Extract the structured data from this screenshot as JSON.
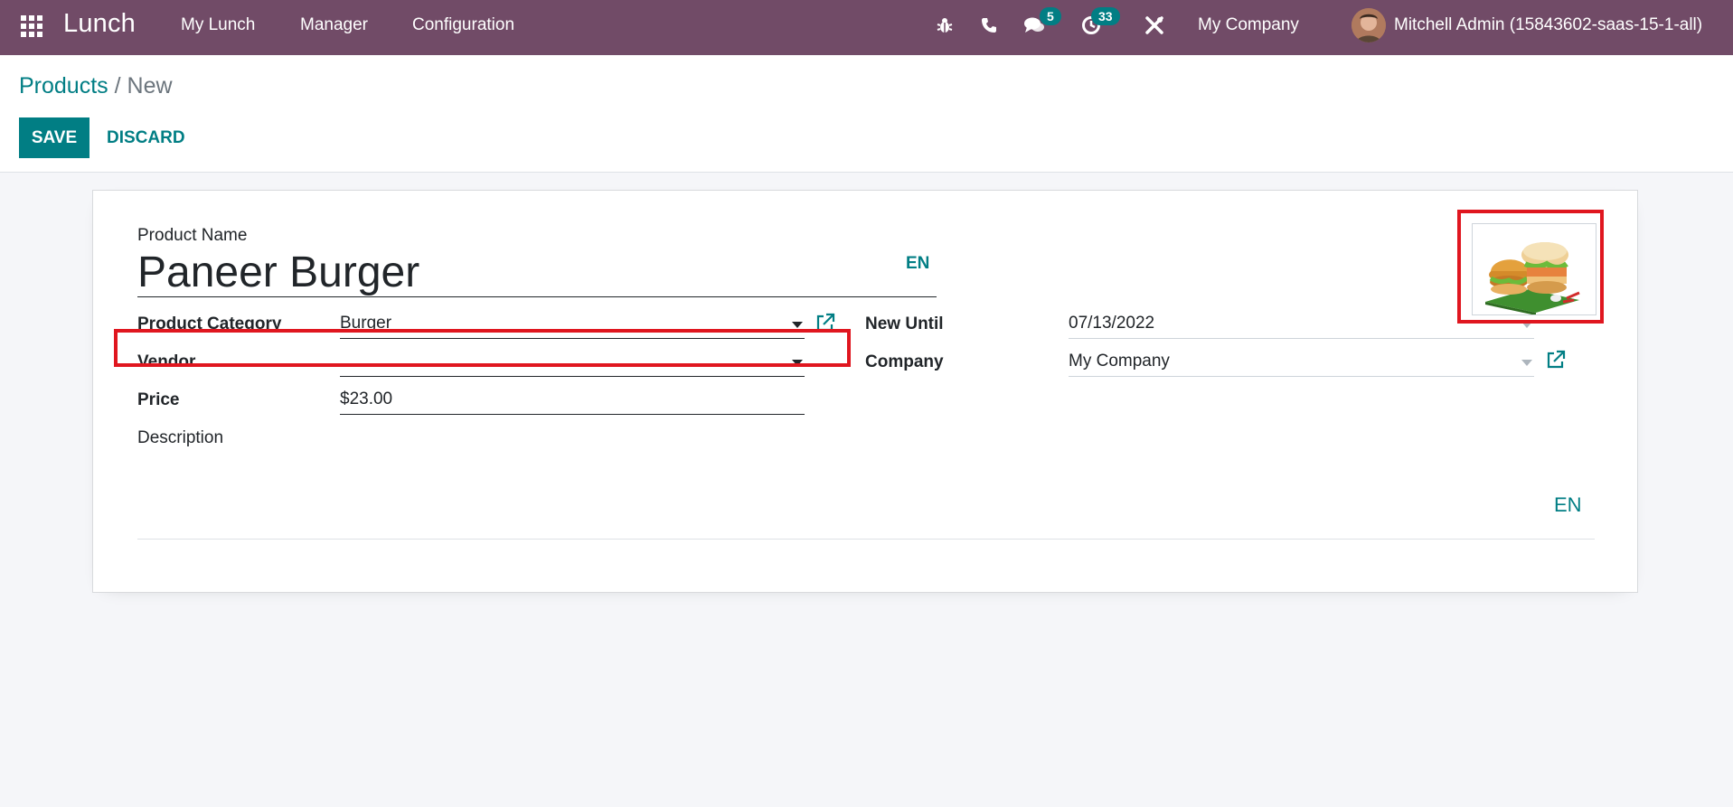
{
  "navbar": {
    "app_name": "Lunch",
    "menus": [
      "My Lunch",
      "Manager",
      "Configuration"
    ],
    "icons": [
      "bug-icon",
      "phone-icon",
      "chat-icon",
      "activity-clock-icon",
      "tools-icon"
    ],
    "messages_badge": "5",
    "activities_badge": "33",
    "company": "My Company",
    "user": "Mitchell Admin (15843602-saas-15-1-all)"
  },
  "breadcrumb": {
    "parent": "Products",
    "separator": " / ",
    "current": "New"
  },
  "buttons": {
    "save": "SAVE",
    "discard": "DISCARD"
  },
  "form": {
    "product_name_label": "Product Name",
    "product_name_value": "Paneer Burger",
    "lang": "EN",
    "product_category_label": "Product Category",
    "product_category_value": "Burger",
    "vendor_label": "Vendor",
    "vendor_value": "",
    "price_label": "Price",
    "price_value": "$23.00",
    "description_label": "Description",
    "description_lang": "EN",
    "new_until_label": "New Until",
    "new_until_value": "07/13/2022",
    "company_label": "Company",
    "company_value": "My Company"
  },
  "colors": {
    "navbar": "#714b67",
    "primary": "#017e84",
    "highlight": "#e0161f"
  }
}
